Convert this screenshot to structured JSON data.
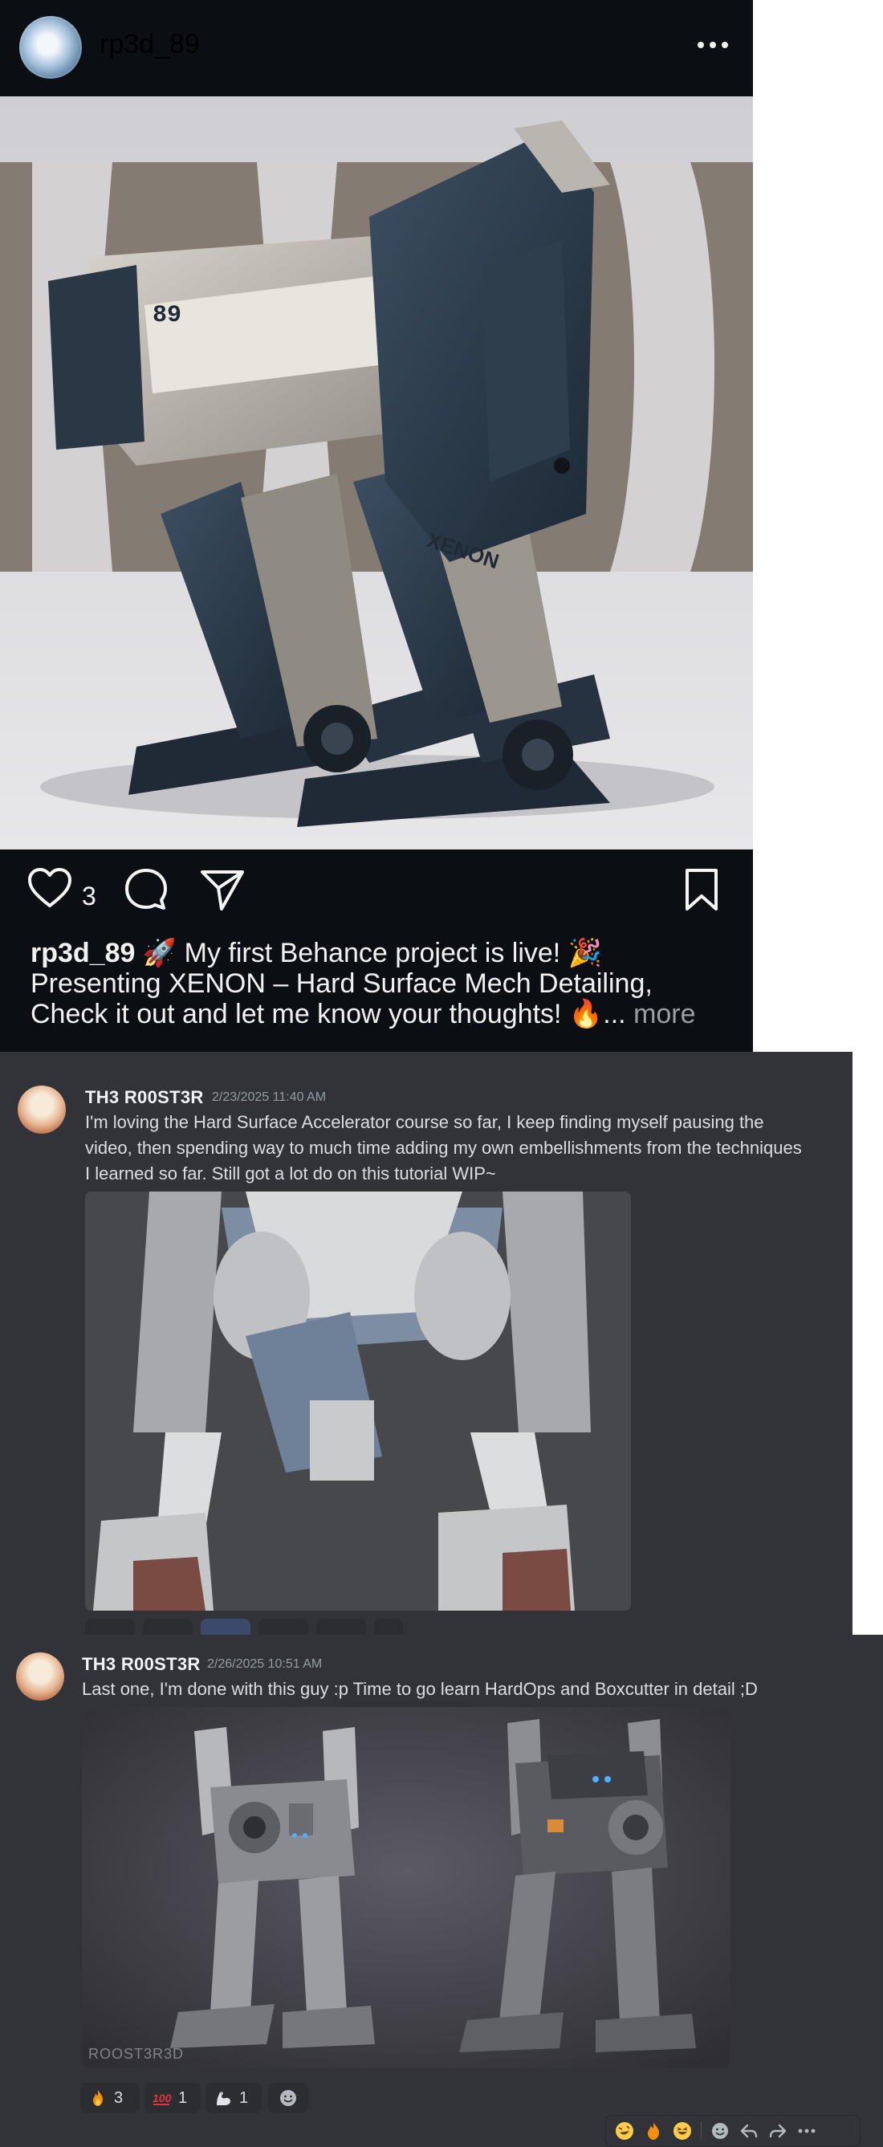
{
  "post": {
    "username": "rp3d_89",
    "like_count": "3",
    "caption": {
      "username": "rp3d_89",
      "line1": " 🚀 My first Behance project is live! 🎉",
      "line2": "Presenting XENON – Hard Surface Mech Detailing,",
      "line3": "Check it out and let me know your thoughts! 🔥",
      "ellipsis": "... ",
      "more": "more"
    },
    "image": {
      "mech_brand": "XENON",
      "mech_number": "89"
    },
    "icons": [
      "more-horizontal-icon",
      "heart-icon",
      "comment-icon",
      "share-icon",
      "bookmark-icon"
    ]
  },
  "messages": [
    {
      "author": "TH3 R00ST3R",
      "timestamp": "2/23/2025 11:40 AM",
      "text": "I'm loving the Hard Surface Accelerator course so far, I keep finding myself pausing the video, then spending way to much time adding my own embellishments from the techniques I learned so far. Still got a lot do on this tutorial WIP~"
    },
    {
      "author": "TH3 R00ST3R",
      "timestamp": "2/26/2025 10:51 AM",
      "text": "Last one, I'm done with this guy :p Time to go learn HardOps and Boxcutter in detail ;D",
      "watermark": "ROOST3R3D",
      "reactions": [
        {
          "emoji": "fire",
          "count": "3"
        },
        {
          "emoji": "hundred",
          "count": "1"
        },
        {
          "emoji": "muscle",
          "count": "1"
        }
      ]
    }
  ],
  "colors": {
    "ig_background": "#0b0f14",
    "discord_background": "#313338",
    "reaction_background": "#2b2d31"
  }
}
